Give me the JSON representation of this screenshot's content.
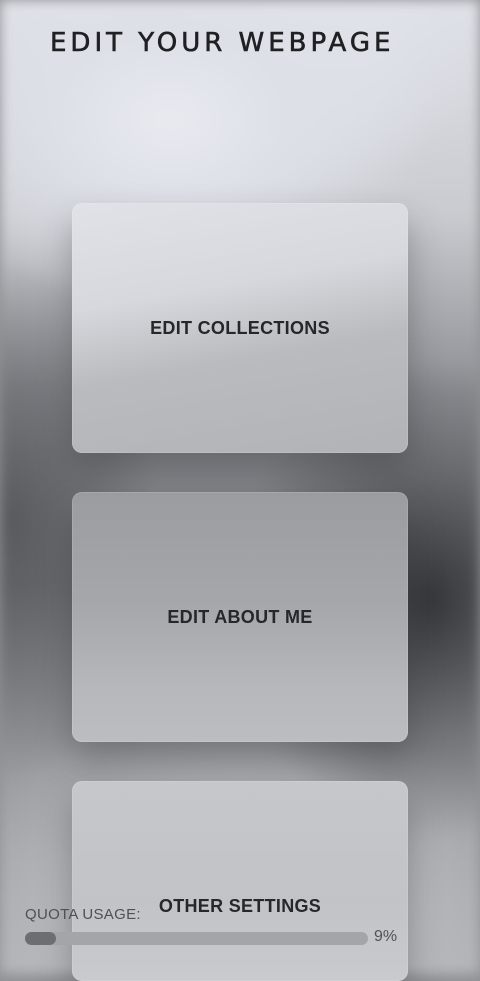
{
  "page": {
    "title": "EDIT YOUR WEBPAGE"
  },
  "cards": [
    {
      "label": "EDIT COLLECTIONS"
    },
    {
      "label": "EDIT ABOUT ME"
    },
    {
      "label": "OTHER SETTINGS"
    }
  ],
  "quota": {
    "label": "QUOTA USAGE:",
    "percent_text": "9%",
    "value": 0.09
  },
  "colors": {
    "text_dark": "#1f2023",
    "quota_fill": "#6c6e72",
    "quota_track": "#a3a5a8"
  }
}
